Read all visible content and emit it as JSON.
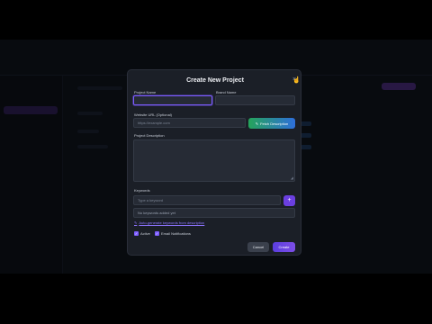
{
  "modal": {
    "title": "Create New Project",
    "close_symbol": "×",
    "project_name": {
      "label": "Project Name",
      "value": "",
      "placeholder": ""
    },
    "brand_name": {
      "label": "Brand Name",
      "value": "",
      "placeholder": ""
    },
    "website_url": {
      "label": "Website URL (Optional)",
      "placeholder": "https://example.com"
    },
    "fetch_button": {
      "label": "Fetch Description",
      "icon": "pencil-icon",
      "icon_glyph": "✎"
    },
    "project_description": {
      "label": "Project Description",
      "value": ""
    },
    "keywords": {
      "label": "Keywords",
      "placeholder": "Type a keyword",
      "add_symbol": "+",
      "empty_text": "No keywords added yet"
    },
    "autogen_link": {
      "label": "Auto-generate keywords from description",
      "icon_glyph": "✎"
    },
    "checkboxes": [
      {
        "label": "Active",
        "checked": true
      },
      {
        "label": "Email Notifications",
        "checked": true
      }
    ],
    "check_glyph": "✓",
    "cancel_label": "Cancel",
    "create_label": "Create"
  },
  "colors": {
    "accent": "#7c5cff",
    "fetch_gradient_start": "#25a45a",
    "fetch_gradient_end": "#2e6fdb",
    "modal_bg": "#1b1f27"
  }
}
